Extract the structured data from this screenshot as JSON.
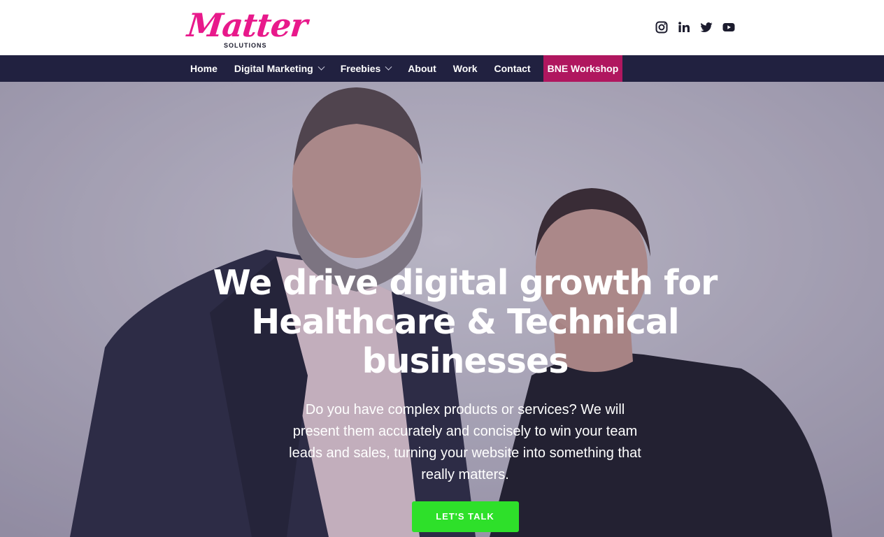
{
  "brand": {
    "logo_text": "Matter",
    "logo_subtext": "SOLUTIONS",
    "brand_color": "#e8198b"
  },
  "socials": [
    {
      "icon": "instagram-icon",
      "label": "Instagram"
    },
    {
      "icon": "linkedin-icon",
      "label": "LinkedIn"
    },
    {
      "icon": "twitter-icon",
      "label": "Twitter"
    },
    {
      "icon": "youtube-icon",
      "label": "YouTube"
    }
  ],
  "nav": {
    "bg_color": "#212140",
    "items": [
      {
        "label": "Home",
        "dropdown": false
      },
      {
        "label": "Digital Marketing",
        "dropdown": true
      },
      {
        "label": "Freebies",
        "dropdown": true
      },
      {
        "label": "About",
        "dropdown": false
      },
      {
        "label": "Work",
        "dropdown": false
      },
      {
        "label": "Contact",
        "dropdown": false
      },
      {
        "label": "BNE Workshop",
        "dropdown": false,
        "highlight_color": "#b0175f"
      }
    ]
  },
  "hero": {
    "title_line1": "We drive digital growth for",
    "title_line2": "Healthcare & Technical",
    "title_line3": "businesses",
    "subtitle": "Do you have complex products or services? We will present them accurately and concisely to win your team leads and sales, turning your website into something that really matters.",
    "cta_label": "LET'S TALK",
    "cta_color": "#2ee02a"
  }
}
